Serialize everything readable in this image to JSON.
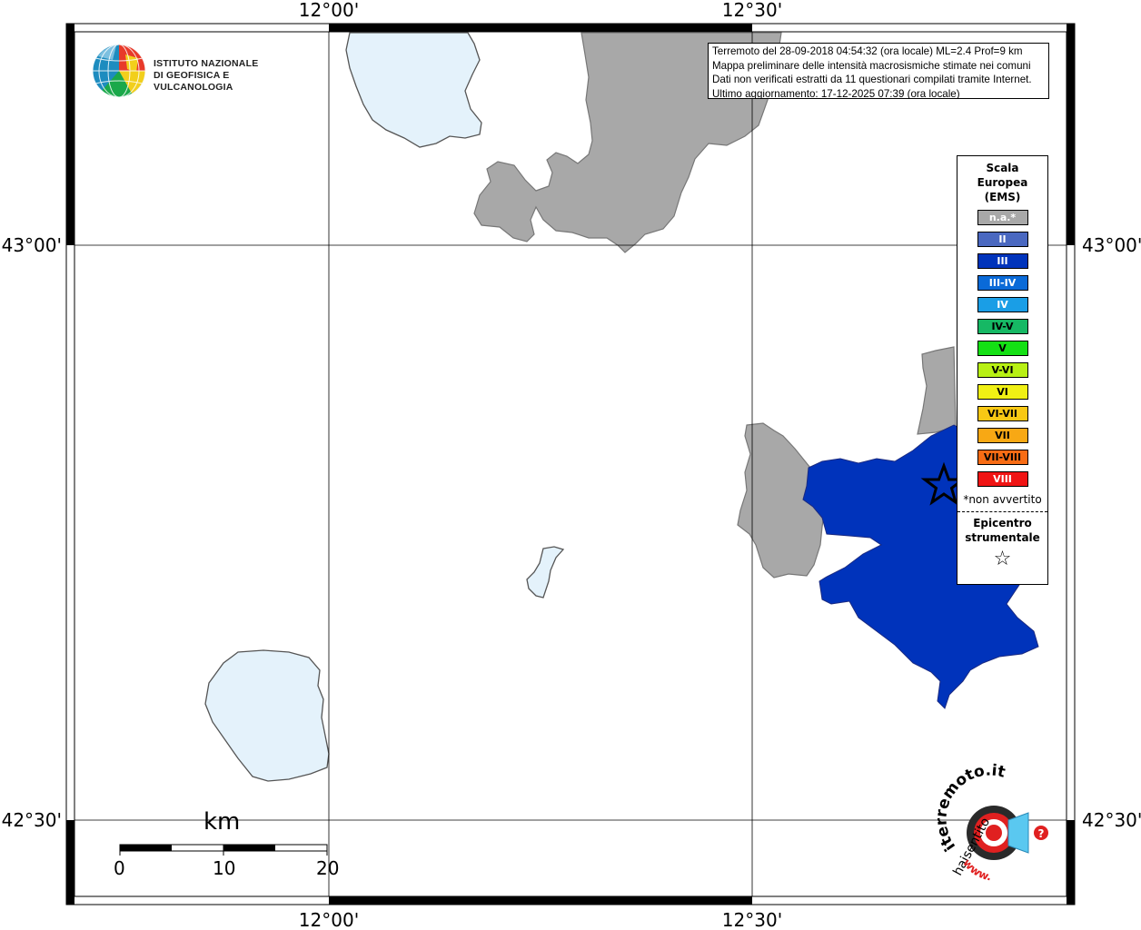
{
  "map": {
    "coords": {
      "lon_left": "12°00'",
      "lon_right": "12°30'",
      "lat_top": "43°00'",
      "lat_bottom": "42°30'"
    },
    "colors": {
      "lake": "#e4f2fb",
      "na_area": "#a8a8a8",
      "intensity_III": "#0033bb",
      "frame": "#000000"
    }
  },
  "logo": {
    "line1": "ISTITUTO NAZIONALE",
    "line2": "DI GEOFISICA E VULCANOLOGIA"
  },
  "info": {
    "line1": "Terremoto del 28-09-2018 04:54:32 (ora locale) ML=2.4 Prof=9 km",
    "line2": "Mappa preliminare delle intensità macrosismiche stimate nei comuni",
    "line3": "Dati non verificati estratti da 11 questionari compilati tramite Internet.",
    "line4": "Ultimo aggiornamento: 17-12-2025 07:39 (ora locale)"
  },
  "legend": {
    "title_line1": "Scala",
    "title_line2": "Europea",
    "title_line3": "(EMS)",
    "items": [
      {
        "label": "n.a.*",
        "color": "#a8a8a8",
        "text_color": "#ffffff"
      },
      {
        "label": "II",
        "color": "#4a68c0",
        "text_color": "#ffffff"
      },
      {
        "label": "III",
        "color": "#0033bb",
        "text_color": "#ffffff"
      },
      {
        "label": "III-IV",
        "color": "#0a6ad8",
        "text_color": "#ffffff"
      },
      {
        "label": "IV",
        "color": "#1a9ee6",
        "text_color": "#ffffff"
      },
      {
        "label": "IV-V",
        "color": "#16b864",
        "text_color": "#000000"
      },
      {
        "label": "V",
        "color": "#14e014",
        "text_color": "#000000"
      },
      {
        "label": "V-VI",
        "color": "#b8f014",
        "text_color": "#000000"
      },
      {
        "label": "VI",
        "color": "#f0f014",
        "text_color": "#000000"
      },
      {
        "label": "VI-VII",
        "color": "#f8c814",
        "text_color": "#000000"
      },
      {
        "label": "VII",
        "color": "#f8a814",
        "text_color": "#000000"
      },
      {
        "label": "VII-VIII",
        "color": "#f86c14",
        "text_color": "#000000"
      },
      {
        "label": "VIII",
        "color": "#f01414",
        "text_color": "#ffffff"
      }
    ],
    "note": "*non avvertito",
    "epicenter_line1": "Epicentro",
    "epicenter_line2": "strumentale",
    "epicenter_symbol": "☆"
  },
  "scale_bar": {
    "unit": "km",
    "ticks": [
      "0",
      "10",
      "20"
    ]
  },
  "badge": {
    "text_top": "iterremoto.it",
    "text_left": "haisentito",
    "text_bottom": "www.",
    "question": "?"
  }
}
